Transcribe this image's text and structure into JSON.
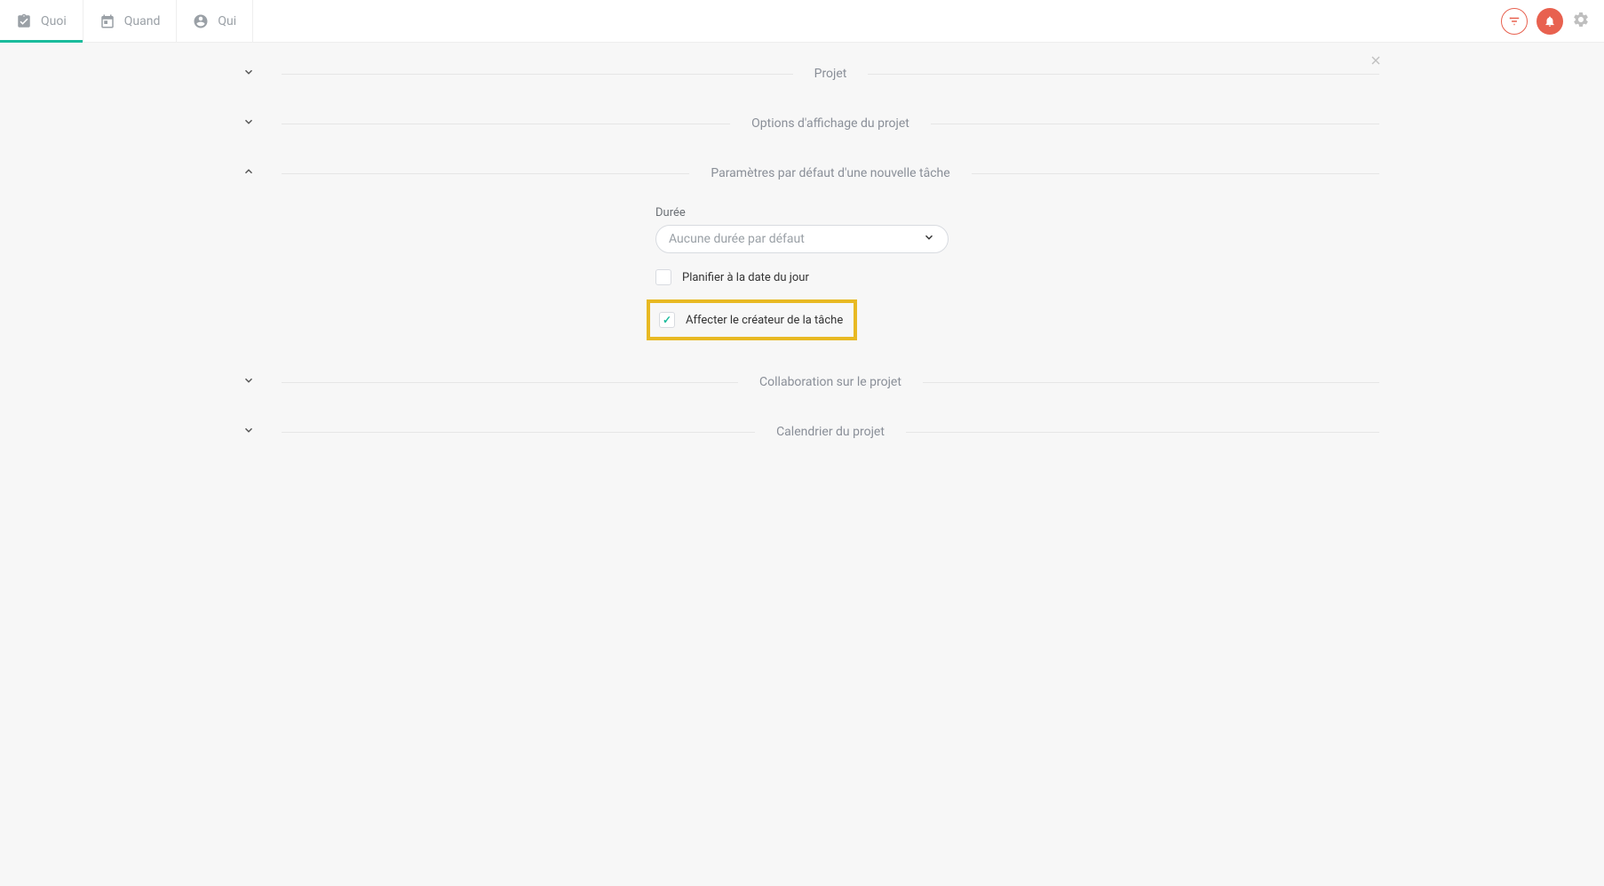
{
  "header": {
    "tabs": [
      {
        "label": "Quoi",
        "active": true
      },
      {
        "label": "Quand",
        "active": false
      },
      {
        "label": "Qui",
        "active": false
      }
    ]
  },
  "sections": {
    "projet": "Projet",
    "options_affichage": "Options d'affichage du projet",
    "parametres_defaut": "Paramètres par défaut d'une nouvelle tâche",
    "collaboration": "Collaboration sur le projet",
    "calendrier": "Calendrier du projet"
  },
  "form": {
    "duree_label": "Durée",
    "duree_value": "Aucune durée par défaut",
    "planifier_label": "Planifier à la date du jour",
    "planifier_checked": false,
    "affecter_label": "Affecter le créateur de la tâche",
    "affecter_checked": true
  }
}
